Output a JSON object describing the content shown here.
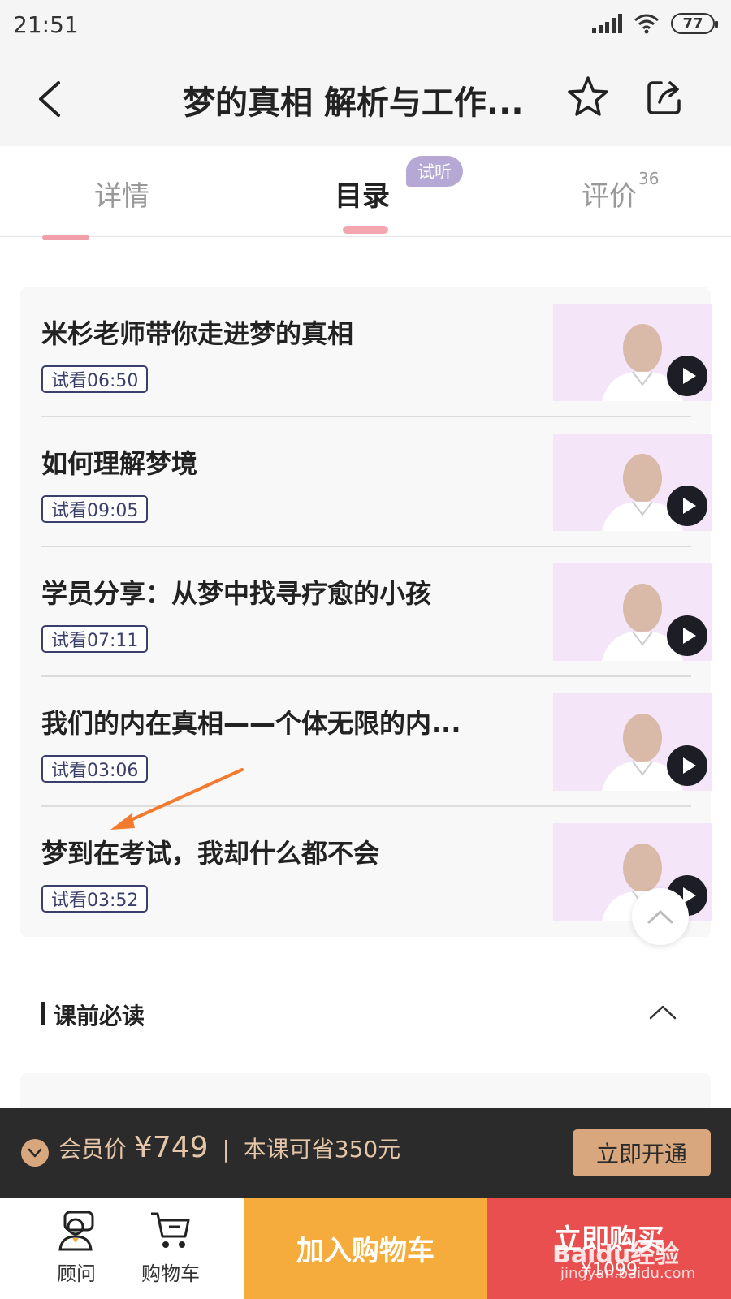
{
  "status_bar": {
    "time": "21:51",
    "battery": "77"
  },
  "nav": {
    "title": "梦的真相 解析与工作..."
  },
  "tabs": {
    "details": "详情",
    "catalog": "目录",
    "trial_badge": "试听",
    "reviews": "评价",
    "reviews_count": "36"
  },
  "lessons": [
    {
      "title": "米杉老师带你走进梦的真相",
      "tag": "试看06:50"
    },
    {
      "title": "如何理解梦境",
      "tag": "试看09:05"
    },
    {
      "title": "学员分享：从梦中找寻疗愈的小孩",
      "tag": "试看07:11"
    },
    {
      "title": "我们的内在真相——个体无限的内...",
      "tag": "试看03:06"
    },
    {
      "title": "梦到在考试，我却什么都不会",
      "tag": "试看03:52"
    }
  ],
  "section": {
    "title": "课前必读"
  },
  "member_bar": {
    "label": "会员价",
    "price": "¥749",
    "separator": "|",
    "saving": "本课可省350元",
    "button": "立即开通"
  },
  "bottom_bar": {
    "consult": "顾问",
    "cart": "购物车",
    "add_to_cart": "加入购物车",
    "buy_now": "立即购买",
    "buy_price": "¥1099"
  },
  "watermark": {
    "text": "Baidu经验",
    "sub": "jingyan.baidu.com"
  },
  "colors": {
    "accent_pink": "#f4a6b0",
    "trial_badge": "#b6a8d4",
    "cart_button": "#f5ac3c",
    "buy_button": "#e94f4f",
    "member_gold": "#d9a77d",
    "annotation_arrow": "#f47a2e"
  }
}
